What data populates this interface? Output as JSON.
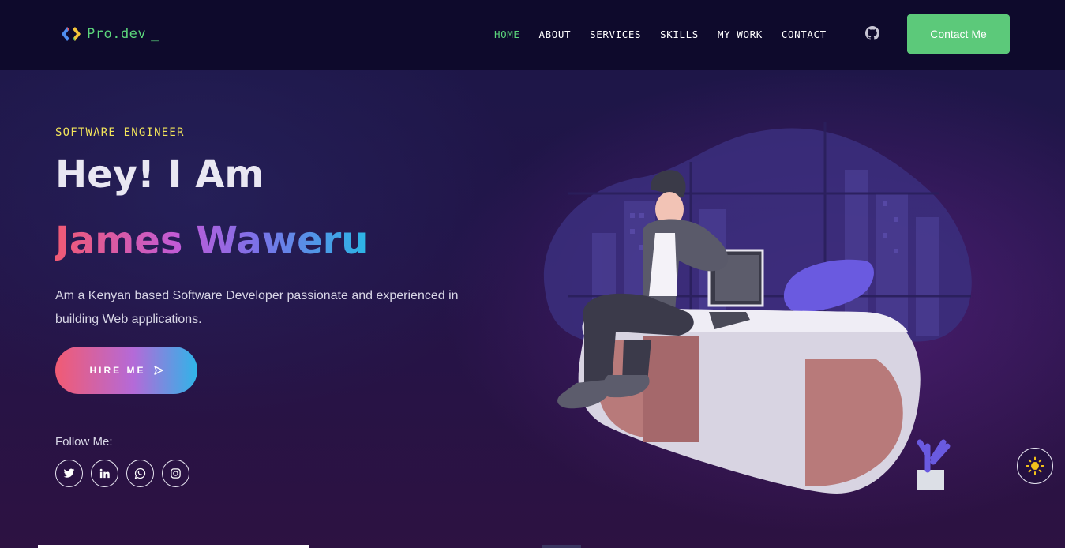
{
  "navbar": {
    "logo_text": "Pro.dev",
    "logo_cursor": "_",
    "links": [
      {
        "label": "HOME",
        "active": true
      },
      {
        "label": "ABOUT",
        "active": false
      },
      {
        "label": "SERVICES",
        "active": false
      },
      {
        "label": "SKILLS",
        "active": false
      },
      {
        "label": "MY WORK",
        "active": false
      },
      {
        "label": "CONTACT",
        "active": false
      }
    ],
    "github_icon": "github-icon",
    "contact_button": "Contact Me"
  },
  "hero": {
    "subtitle": "SOFTWARE ENGINEER",
    "greeting": "Hey! I Am",
    "name": "James Waweru",
    "description": "Am a Kenyan based Software Developer passionate and experienced in building Web applications.",
    "hire_button": "HIRE ME",
    "follow_label": "Follow Me:",
    "socials": [
      "twitter-icon",
      "linkedin-icon",
      "whatsapp-icon",
      "instagram-icon"
    ]
  },
  "theme_toggle_icon": "sun-icon",
  "colors": {
    "accent_green": "#5cc97a",
    "subtitle_yellow": "#f3e55a",
    "nav_bg": "#0e0a2c",
    "name_gradient": [
      "#f05a74",
      "#c05bd8",
      "#7a72e8",
      "#2bb6e6"
    ]
  }
}
